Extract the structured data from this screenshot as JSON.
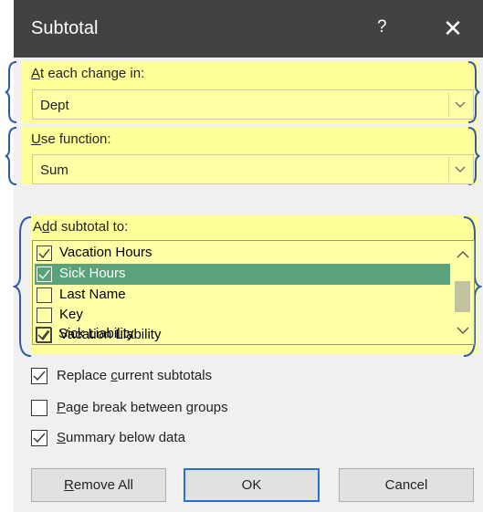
{
  "dialog": {
    "title": "Subtotal",
    "help": "?",
    "close": "✕"
  },
  "at_each_change": {
    "label_key": "A",
    "label_rest": "t each change in:",
    "value": "Dept"
  },
  "use_function": {
    "label_key": "U",
    "label_rest": "se function:",
    "value": "Sum"
  },
  "add_subtotal": {
    "label_pre": "A",
    "label_key": "d",
    "label_rest": "d subtotal to:",
    "items": [
      {
        "label": "Vacation Hours",
        "checked": true,
        "selected": false
      },
      {
        "label": "Sick Hours",
        "checked": true,
        "selected": true
      },
      {
        "label": "Last Name",
        "checked": false,
        "selected": false
      },
      {
        "label": "Key",
        "checked": false,
        "selected": false
      },
      {
        "label": "Vacation Liability",
        "checked": true,
        "selected": false
      },
      {
        "label": "Sick Liability",
        "checked": true,
        "selected": false
      }
    ]
  },
  "options": {
    "replace": {
      "pre": "Replace ",
      "key": "c",
      "rest": "urrent subtotals",
      "checked": true
    },
    "page_break": {
      "pre": "",
      "key": "P",
      "rest": "age break between groups",
      "checked": false
    },
    "summary": {
      "pre": "",
      "key": "S",
      "rest": "ummary below data",
      "checked": true
    }
  },
  "buttons": {
    "remove_key": "R",
    "remove_rest": "emove All",
    "ok": "OK",
    "cancel": "Cancel"
  },
  "colors": {
    "highlight": "#ffff9a",
    "brace": "#2f5aa8",
    "selection": "#5aa37a",
    "titlebar": "#424242"
  }
}
